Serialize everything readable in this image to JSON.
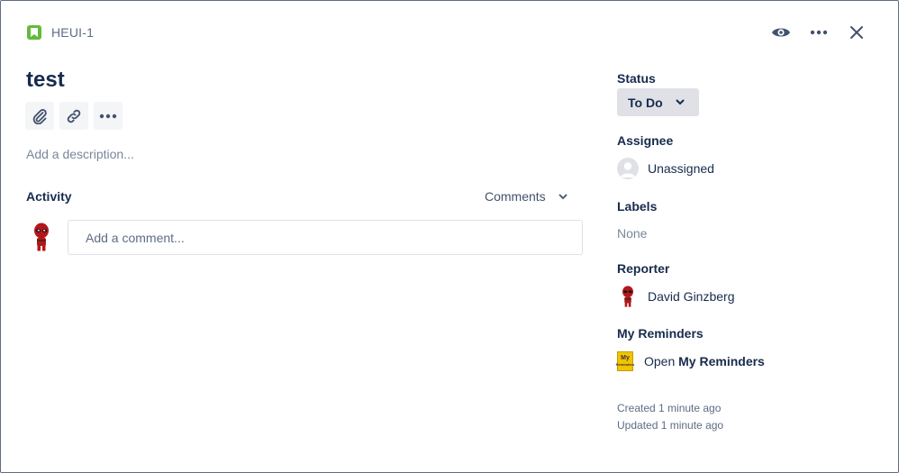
{
  "issue": {
    "key": "HEUI-1",
    "title": "test",
    "description_placeholder": "Add a description..."
  },
  "header_actions": [
    {
      "icon": "eye-icon",
      "name": "watch-button"
    },
    {
      "icon": "more-icon",
      "name": "more-actions-button"
    },
    {
      "icon": "close-icon",
      "name": "close-button"
    }
  ],
  "toolbar": [
    {
      "icon": "attachment-icon"
    },
    {
      "icon": "link-icon"
    },
    {
      "icon": "more-icon"
    }
  ],
  "activity": {
    "label": "Activity",
    "filter": "Comments",
    "comment_placeholder": "Add a comment..."
  },
  "sidebar": {
    "status": {
      "label": "Status",
      "value": "To Do"
    },
    "assignee": {
      "label": "Assignee",
      "value": "Unassigned"
    },
    "labels": {
      "label": "Labels",
      "value": "None"
    },
    "reporter": {
      "label": "Reporter",
      "value": "David Ginzberg"
    },
    "reminders": {
      "label": "My Reminders",
      "prefix": "Open",
      "link": "My Reminders",
      "icon_text_top": "My",
      "icon_text_bottom": "Reminders"
    },
    "created": "Created 1 minute ago",
    "updated": "Updated 1 minute ago"
  },
  "colors": {
    "accent_story": "#63ba3c",
    "text_primary": "#172b4d",
    "text_muted": "#7a869a",
    "button_bg": "#f4f5f7",
    "status_bg": "#dfe1e6"
  }
}
